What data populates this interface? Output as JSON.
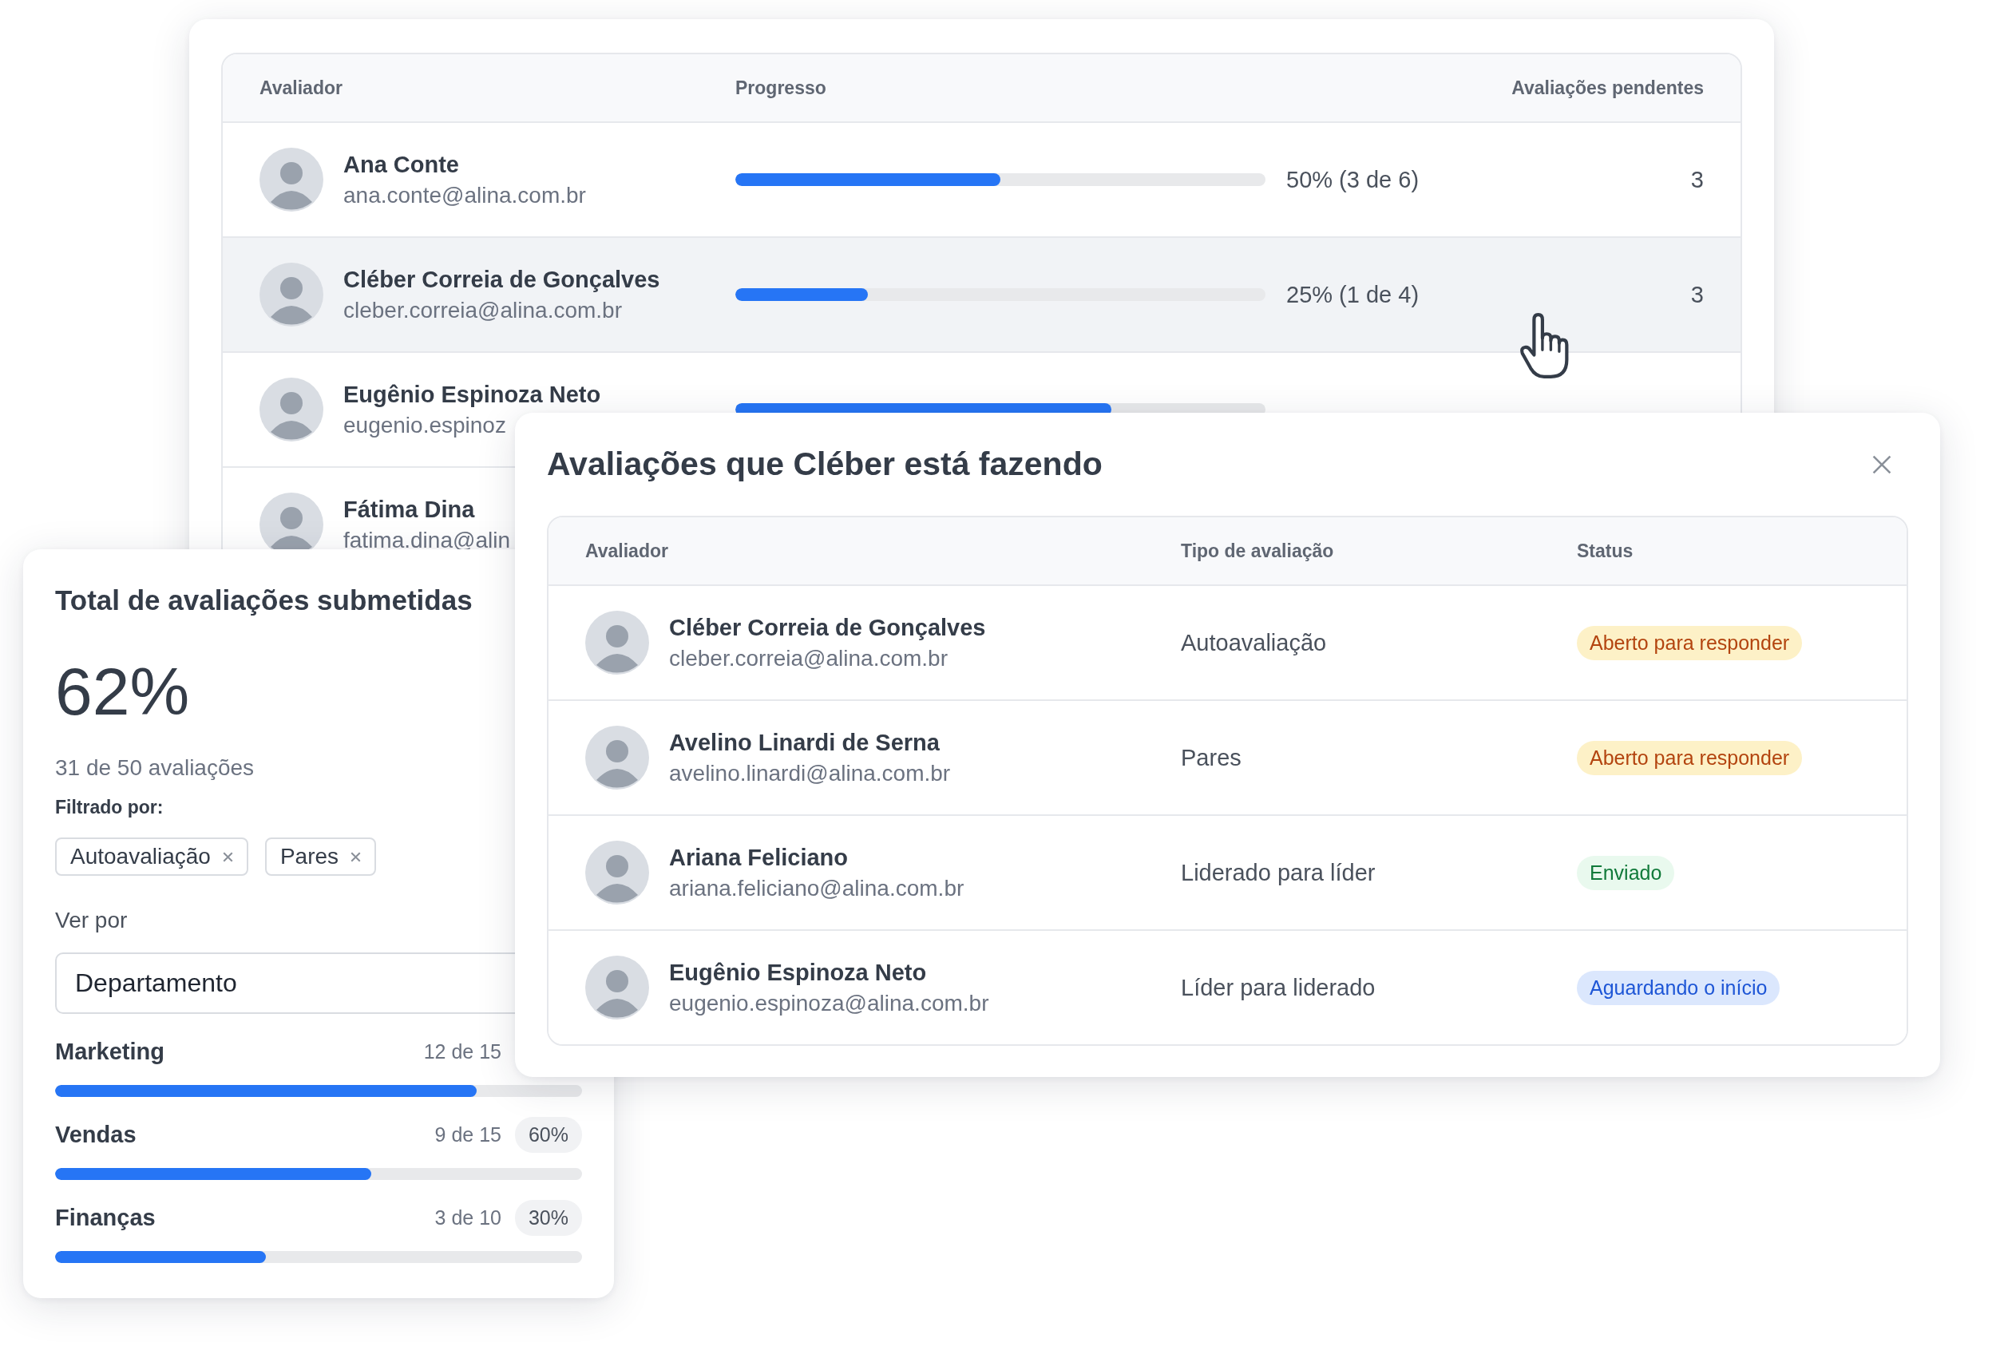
{
  "evaluators_table": {
    "columns": [
      "Avaliador",
      "Progresso",
      "Avaliações pendentes"
    ],
    "rows": [
      {
        "name": "Ana Conte",
        "email": "ana.conte@alina.com.br",
        "level": 0.5,
        "progress": "50% (3 de 6)",
        "pending": "3",
        "selected": false
      },
      {
        "name": "Cléber Correia de Gonçalves",
        "email": "cleber.correia@alina.com.br",
        "level": 0.25,
        "progress": "25% (1 de 4)",
        "pending": "3",
        "selected": true
      },
      {
        "name": "Eugênio Espinoza Neto",
        "email": "eugenio.espinoz",
        "level": 0.71,
        "selected": false
      },
      {
        "name": "Fátima Dina",
        "email": "fatima.dina@alin",
        "selected": false
      }
    ]
  },
  "summary": {
    "title": "Total de avaliações submetidas",
    "percent": "62%",
    "count": "31 de 50 avaliações",
    "filter_label": "Filtrado por:",
    "filters": [
      "Autoavaliação",
      "Pares"
    ],
    "view_by_label": "Ver por",
    "view_by_value": "Departamento",
    "departments": [
      {
        "name": "Marketing",
        "count": "12 de 15",
        "level": 0.8
      },
      {
        "name": "Vendas",
        "count": "9 de 15",
        "percent": "60%",
        "level": 0.6
      },
      {
        "name": "Finanças",
        "count": "3 de 10",
        "percent": "30%",
        "level": 0.4
      }
    ]
  },
  "modal": {
    "title": "Avaliações que Cléber está fazendo",
    "columns": [
      "Avaliador",
      "Tipo de avaliação",
      "Status"
    ],
    "rows": [
      {
        "name": "Cléber Correia de Gonçalves",
        "email": "cleber.correia@alina.com.br",
        "type": "Autoavaliação",
        "status": "Aberto para responder",
        "kind": "open"
      },
      {
        "name": "Avelino Linardi de Serna",
        "email": "avelino.linardi@alina.com.br",
        "type": "Pares",
        "status": "Aberto para responder",
        "kind": "open"
      },
      {
        "name": "Ariana Feliciano",
        "email": "ariana.feliciano@alina.com.br",
        "type": "Liderado para líder",
        "status": "Enviado",
        "kind": "sent"
      },
      {
        "name": "Eugênio Espinoza Neto",
        "email": "eugenio.espinoza@alina.com.br",
        "type": "Líder para liderado",
        "status": "Aguardando o início",
        "kind": "waiting"
      }
    ]
  }
}
